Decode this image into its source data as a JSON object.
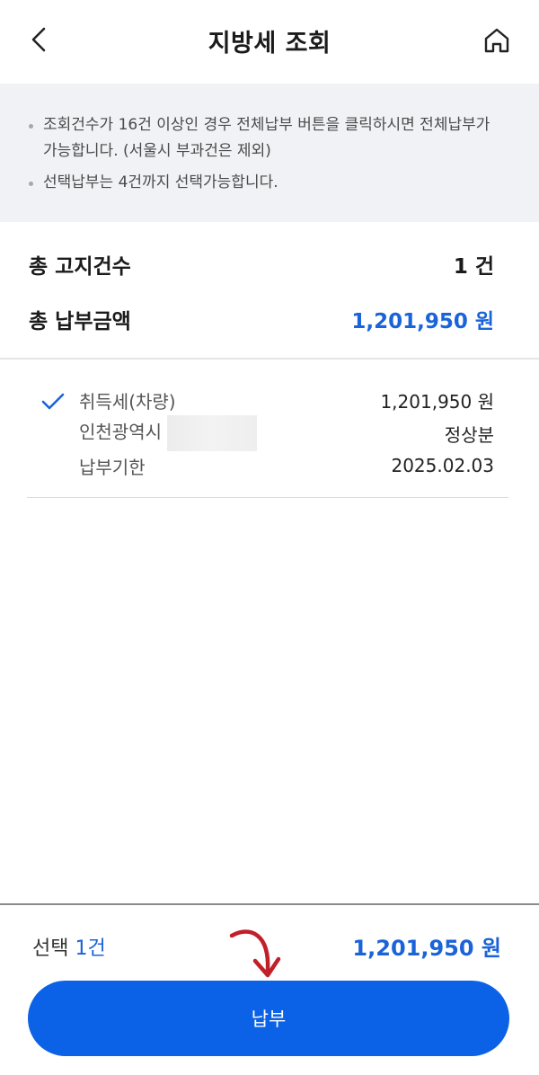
{
  "header": {
    "title": "지방세 조회"
  },
  "notice": {
    "items": [
      "조회건수가 16건 이상인 경우 전체납부 버튼을 클릭하시면 전체납부가 가능합니다. (서울시 부과건은 제외)",
      "선택납부는 4건까지 선택가능합니다."
    ]
  },
  "summary": {
    "total_count_label": "총 고지건수",
    "total_count_value": "1 건",
    "total_amount_label": "총 납부금액",
    "total_amount_value": "1,201,950 원"
  },
  "tax_items": [
    {
      "checked": true,
      "name": "취득세(차량)",
      "amount": "1,201,950 원",
      "region": "인천광역시",
      "type": "정상분",
      "due_label": "납부기한",
      "due_date": "2025.02.03"
    }
  ],
  "footer": {
    "selected_prefix": "선택 ",
    "selected_count": "1건",
    "selected_amount": "1,201,950 원",
    "pay_button": "납부"
  },
  "colors": {
    "accent": "#1a63d8",
    "button": "#0b62e6",
    "notice_bg": "#f1f2f6",
    "annotation_arrow": "#c0202a"
  }
}
